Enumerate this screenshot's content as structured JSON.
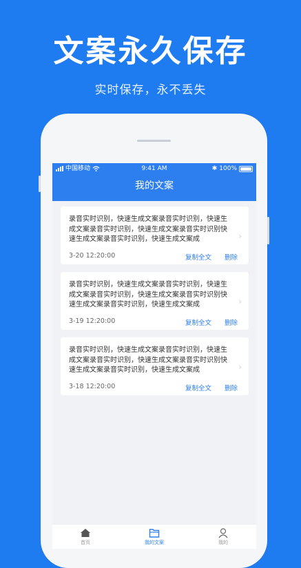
{
  "promo": {
    "title": "文案永久保存",
    "subtitle": "实时保存，永不丢失"
  },
  "status_bar": {
    "carrier": "中国移动",
    "time": "9:41 AM",
    "battery": "100%"
  },
  "nav": {
    "title": "我的文案"
  },
  "cards": [
    {
      "text": "录音实时识别，快速生成文案录音实时识别，快速生成文案录音实时识别，快速生成文案录音实时识别快速生成文案录音实时识别，快速生成文案成",
      "date": "3-20 12:20:00",
      "copy_label": "复制全文",
      "delete_label": "删除"
    },
    {
      "text": "录音实时识别，快速生成文案录音实时识别，快速生成文案录音实时识别，快速生成文案录音实时识别快速生成文案录音实时识别，快速生成文案成",
      "date": "3-19 12:20:00",
      "copy_label": "复制全文",
      "delete_label": "删除"
    },
    {
      "text": "录音实时识别，快速生成文案录音实时识别，快速生成文案录音实时识别，快速生成文案录音实时识别快速生成文案录音实时识别，快速生成文案成",
      "date": "3-18 12:20:00",
      "copy_label": "复制全文",
      "delete_label": "删除"
    }
  ],
  "tabs": [
    {
      "label": "首页",
      "icon": "home-icon",
      "active": false
    },
    {
      "label": "我的文案",
      "icon": "folder-icon",
      "active": true
    },
    {
      "label": "我的",
      "icon": "user-icon",
      "active": false
    }
  ],
  "colors": {
    "background": "#1f7cf0",
    "accent": "#2d7ff0"
  }
}
